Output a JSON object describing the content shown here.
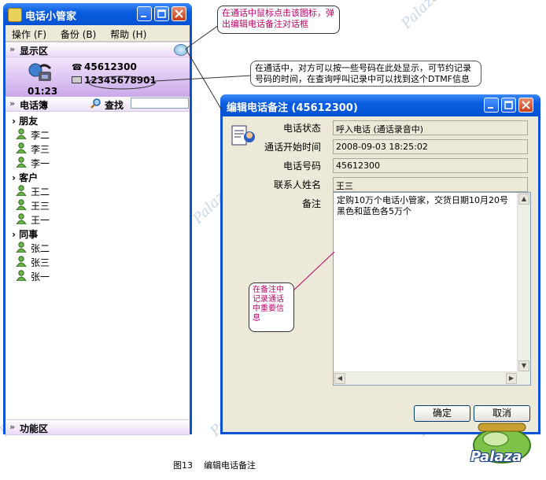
{
  "main_window": {
    "title": "电话小管家",
    "menu": [
      "操作 (F)",
      "备份 (B)",
      "帮助 (H)"
    ],
    "display_section": "显示区",
    "display": {
      "number": "45612300",
      "dtmf": "12345678901",
      "duration": "01:23"
    },
    "phonebook_section": "电话簿",
    "search_label": "查找",
    "search_value": "",
    "groups": [
      {
        "name": "朋友",
        "members": [
          "李二",
          "李三",
          "李一"
        ]
      },
      {
        "name": "客户",
        "members": [
          "王二",
          "王三",
          "王一"
        ]
      },
      {
        "name": "同事",
        "members": [
          "张二",
          "张三",
          "张一"
        ]
      }
    ],
    "function_section": "功能区"
  },
  "dialog": {
    "title": "编辑电话备注 (45612300)",
    "fields": [
      {
        "label": "电话状态",
        "value": "呼入电话 (通话录音中)"
      },
      {
        "label": "通话开始时间",
        "value": "2008-09-03 18:25:02"
      },
      {
        "label": "电话号码",
        "value": "45612300"
      },
      {
        "label": "联系人姓名",
        "value": "王三"
      }
    ],
    "memo_label": "备注",
    "memo_text": "定购10万个电话小管家，交货日期10月20号黑色和蓝色各5万个",
    "ok_label": "确定",
    "cancel_label": "取消"
  },
  "callouts": {
    "c1": "在通话中鼠标点击该图标，弹出编辑电话备注对话框",
    "c2": "在通话中，对方可以按一些号码在此处显示，可节约记录号码的时间，在查询呼叫记录中可以找到这个DTMF信息",
    "c3": "在备注中记录通话中重要信息"
  },
  "caption": "图13    编辑电话备注",
  "watermark": "Palaza",
  "logo_text": "Palaza",
  "colors": {
    "titlebar": "#0a52d6",
    "callout_text": "#c0006a",
    "section_bar": "#ecd9f7"
  }
}
